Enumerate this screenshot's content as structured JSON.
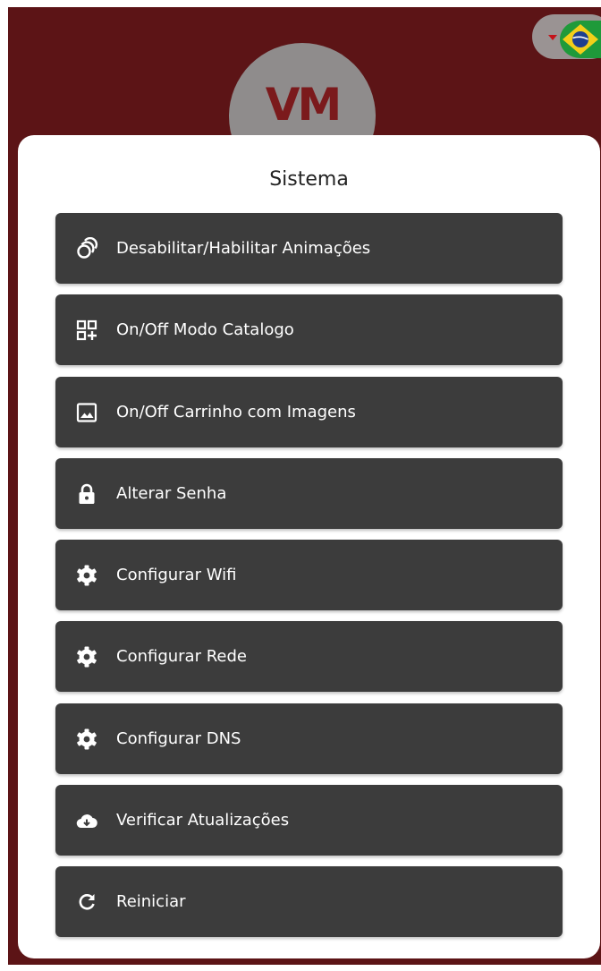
{
  "header": {
    "logo_text": "VM",
    "language_flag": "brazil-flag-icon"
  },
  "modal": {
    "title": "Sistema",
    "items": [
      {
        "label": "Desabilitar/Habilitar Animações",
        "icon": "animation-icon"
      },
      {
        "label": "On/Off Modo Catalogo",
        "icon": "catalog-grid-icon"
      },
      {
        "label": "On/Off Carrinho com Imagens",
        "icon": "image-icon"
      },
      {
        "label": "Alterar Senha",
        "icon": "lock-icon"
      },
      {
        "label": "Configurar Wifi",
        "icon": "gear-icon"
      },
      {
        "label": "Configurar Rede",
        "icon": "gear-icon"
      },
      {
        "label": "Configurar DNS",
        "icon": "gear-icon"
      },
      {
        "label": "Verificar Atualizações",
        "icon": "cloud-download-icon"
      },
      {
        "label": "Reiniciar",
        "icon": "restart-icon"
      }
    ]
  },
  "colors": {
    "backdrop": "#5c1416",
    "button_background": "#3c3c3c",
    "button_text": "#ffffff",
    "modal_background": "#ffffff"
  }
}
